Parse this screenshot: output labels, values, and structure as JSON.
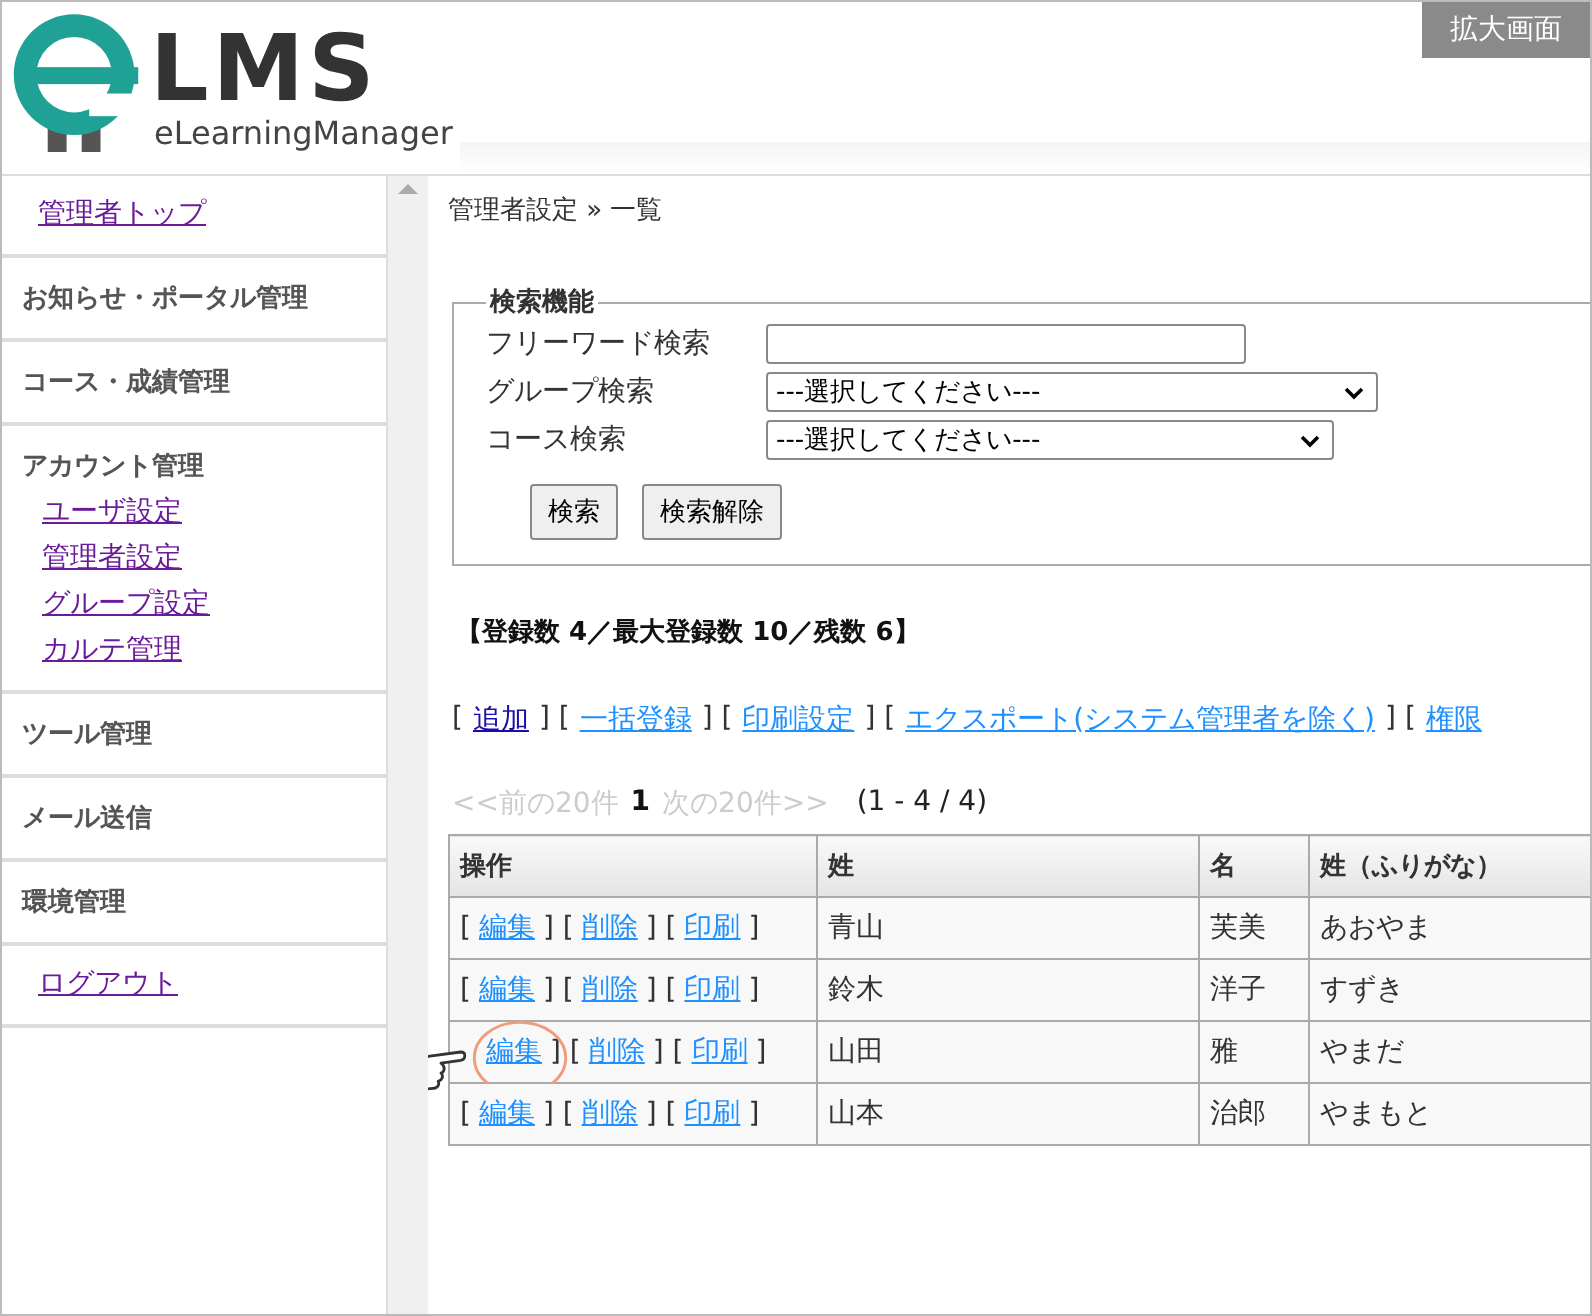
{
  "logo": {
    "text": "LMS",
    "subtitle": "eLearningManager"
  },
  "badge": "拡大画面",
  "sidebar": [
    {
      "kind": "link",
      "label": "管理者トップ",
      "visited": true
    },
    {
      "kind": "heading",
      "label": "お知らせ・ポータル管理"
    },
    {
      "kind": "heading",
      "label": "コース・成績管理"
    },
    {
      "kind": "heading",
      "label": "アカウント管理",
      "children": [
        {
          "label": "ユーザ設定",
          "visited": true
        },
        {
          "label": "管理者設定",
          "visited": true
        },
        {
          "label": "グループ設定",
          "visited": true
        },
        {
          "label": "カルテ管理",
          "visited": true
        }
      ]
    },
    {
      "kind": "heading",
      "label": "ツール管理"
    },
    {
      "kind": "heading",
      "label": "メール送信"
    },
    {
      "kind": "heading",
      "label": "環境管理"
    },
    {
      "kind": "link",
      "label": "ログアウト",
      "visited": true
    }
  ],
  "breadcrumb": "管理者設定 » 一覧",
  "search": {
    "legend": "検索機能",
    "fields": [
      {
        "kind": "text",
        "label": "フリーワード検索"
      },
      {
        "kind": "select",
        "label": "グループ検索",
        "value": "---選択してください---"
      },
      {
        "kind": "select",
        "label": "コース検索",
        "value": "---選択してください---"
      }
    ],
    "buttons": [
      "検索",
      "検索解除"
    ]
  },
  "summary": "【登録数 4／最大登録数 10／残数 6】",
  "actions": [
    {
      "kind": "text",
      "text": "["
    },
    {
      "kind": "link",
      "text": "追加",
      "visited": true
    },
    {
      "kind": "text",
      "text": "] ["
    },
    {
      "kind": "link",
      "text": "一括登録",
      "visited": false
    },
    {
      "kind": "text",
      "text": "] ["
    },
    {
      "kind": "link",
      "text": "印刷設定",
      "visited": false
    },
    {
      "kind": "text",
      "text": "] ["
    },
    {
      "kind": "link",
      "text": "エクスポート(システム管理者を除く)",
      "visited": false
    },
    {
      "kind": "text",
      "text": "] ["
    },
    {
      "kind": "link",
      "text": "権限",
      "visited": false
    }
  ],
  "pager": {
    "prev": "<<前の20件",
    "page": "1",
    "next": "次の20件>>",
    "range": "(1 - 4 / 4)"
  },
  "table": {
    "columns": [
      "操作",
      "姓",
      "名",
      "姓（ふりがな）"
    ],
    "rows": [
      {
        "pointed": false,
        "cells": [
          {
            "kind": "ops",
            "parts": [
              {
                "kind": "text",
                "text": "["
              },
              {
                "kind": "link",
                "text": "編集"
              },
              {
                "kind": "text",
                "text": "] ["
              },
              {
                "kind": "link",
                "text": "削除"
              },
              {
                "kind": "text",
                "text": "] ["
              },
              {
                "kind": "link",
                "text": "印刷"
              },
              {
                "kind": "text",
                "text": "]"
              }
            ]
          },
          {
            "kind": "text",
            "text": "青山"
          },
          {
            "kind": "text",
            "text": "芙美"
          },
          {
            "kind": "text",
            "text": "あおやま"
          }
        ]
      },
      {
        "pointed": false,
        "cells": [
          {
            "kind": "ops",
            "parts": [
              {
                "kind": "text",
                "text": "["
              },
              {
                "kind": "link",
                "text": "編集"
              },
              {
                "kind": "text",
                "text": "] ["
              },
              {
                "kind": "link",
                "text": "削除"
              },
              {
                "kind": "text",
                "text": "] ["
              },
              {
                "kind": "link",
                "text": "印刷"
              },
              {
                "kind": "text",
                "text": "]"
              }
            ]
          },
          {
            "kind": "text",
            "text": "鈴木"
          },
          {
            "kind": "text",
            "text": "洋子"
          },
          {
            "kind": "text",
            "text": "すずき"
          }
        ]
      },
      {
        "pointed": true,
        "cells": [
          {
            "kind": "ops",
            "parts": [
              {
                "kind": "link",
                "text": "編集"
              },
              {
                "kind": "text",
                "text": "] ["
              },
              {
                "kind": "link",
                "text": "削除"
              },
              {
                "kind": "text",
                "text": "] ["
              },
              {
                "kind": "link",
                "text": "印刷"
              },
              {
                "kind": "text",
                "text": "]"
              }
            ]
          },
          {
            "kind": "text",
            "text": "山田"
          },
          {
            "kind": "text",
            "text": "雅"
          },
          {
            "kind": "text",
            "text": "やまだ"
          }
        ]
      },
      {
        "pointed": false,
        "cells": [
          {
            "kind": "ops",
            "parts": [
              {
                "kind": "text",
                "text": "["
              },
              {
                "kind": "link",
                "text": "編集"
              },
              {
                "kind": "text",
                "text": "] ["
              },
              {
                "kind": "link",
                "text": "削除"
              },
              {
                "kind": "text",
                "text": "] ["
              },
              {
                "kind": "link",
                "text": "印刷"
              },
              {
                "kind": "text",
                "text": "]"
              }
            ]
          },
          {
            "kind": "text",
            "text": "山本"
          },
          {
            "kind": "text",
            "text": "治郎"
          },
          {
            "kind": "text",
            "text": "やまもと"
          }
        ]
      }
    ]
  }
}
